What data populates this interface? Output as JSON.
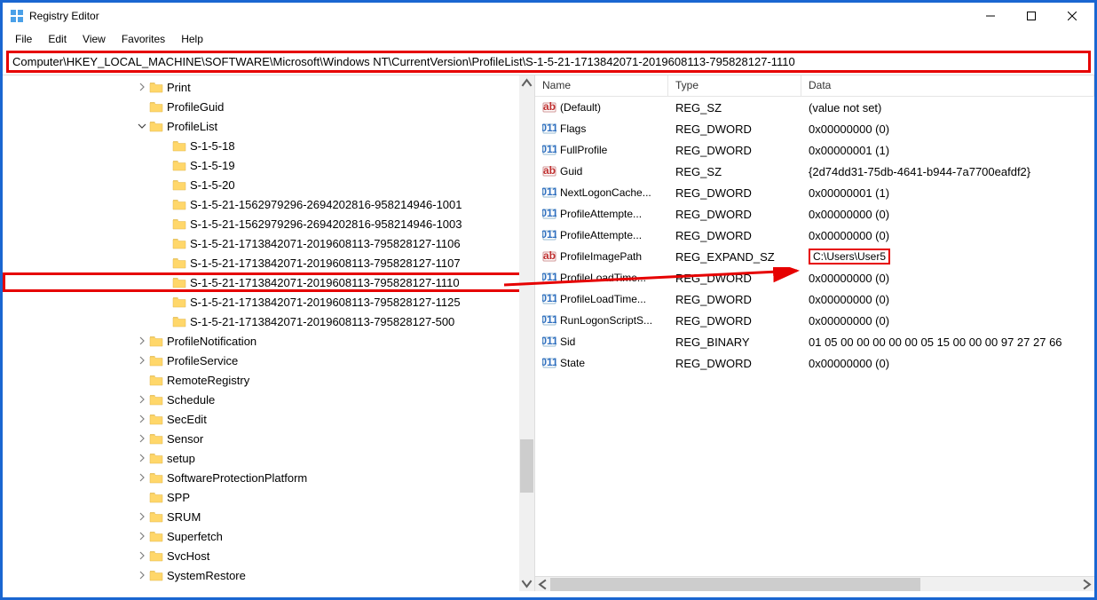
{
  "window": {
    "title": "Registry Editor"
  },
  "menubar": [
    "File",
    "Edit",
    "View",
    "Favorites",
    "Help"
  ],
  "addressbar": "Computer\\HKEY_LOCAL_MACHINE\\SOFTWARE\\Microsoft\\Windows NT\\CurrentVersion\\ProfileList\\S-1-5-21-1713842071-2019608113-795828127-1110",
  "tree": [
    {
      "indent": 150,
      "expander": "right",
      "label": "Print"
    },
    {
      "indent": 150,
      "expander": "",
      "label": "ProfileGuid"
    },
    {
      "indent": 150,
      "expander": "down",
      "label": "ProfileList"
    },
    {
      "indent": 176,
      "expander": "",
      "label": "S-1-5-18"
    },
    {
      "indent": 176,
      "expander": "",
      "label": "S-1-5-19"
    },
    {
      "indent": 176,
      "expander": "",
      "label": "S-1-5-20"
    },
    {
      "indent": 176,
      "expander": "",
      "label": "S-1-5-21-1562979296-2694202816-958214946-1001"
    },
    {
      "indent": 176,
      "expander": "",
      "label": "S-1-5-21-1562979296-2694202816-958214946-1003"
    },
    {
      "indent": 176,
      "expander": "",
      "label": "S-1-5-21-1713842071-2019608113-795828127-1106"
    },
    {
      "indent": 176,
      "expander": "",
      "label": "S-1-5-21-1713842071-2019608113-795828127-1107"
    },
    {
      "indent": 176,
      "expander": "",
      "label": "S-1-5-21-1713842071-2019608113-795828127-1110",
      "selected": true
    },
    {
      "indent": 176,
      "expander": "",
      "label": "S-1-5-21-1713842071-2019608113-795828127-1125"
    },
    {
      "indent": 176,
      "expander": "",
      "label": "S-1-5-21-1713842071-2019608113-795828127-500"
    },
    {
      "indent": 150,
      "expander": "right",
      "label": "ProfileNotification"
    },
    {
      "indent": 150,
      "expander": "right",
      "label": "ProfileService"
    },
    {
      "indent": 150,
      "expander": "",
      "label": "RemoteRegistry"
    },
    {
      "indent": 150,
      "expander": "right",
      "label": "Schedule"
    },
    {
      "indent": 150,
      "expander": "right",
      "label": "SecEdit"
    },
    {
      "indent": 150,
      "expander": "right",
      "label": "Sensor"
    },
    {
      "indent": 150,
      "expander": "right",
      "label": "setup"
    },
    {
      "indent": 150,
      "expander": "right",
      "label": "SoftwareProtectionPlatform"
    },
    {
      "indent": 150,
      "expander": "",
      "label": "SPP"
    },
    {
      "indent": 150,
      "expander": "right",
      "label": "SRUM"
    },
    {
      "indent": 150,
      "expander": "right",
      "label": "Superfetch"
    },
    {
      "indent": 150,
      "expander": "right",
      "label": "SvcHost"
    },
    {
      "indent": 150,
      "expander": "right",
      "label": "SystemRestore"
    }
  ],
  "list": {
    "headers": {
      "name": "Name",
      "type": "Type",
      "data": "Data"
    },
    "rows": [
      {
        "icon": "str",
        "name": "(Default)",
        "type": "REG_SZ",
        "data": "(value not set)"
      },
      {
        "icon": "bin",
        "name": "Flags",
        "type": "REG_DWORD",
        "data": "0x00000000 (0)"
      },
      {
        "icon": "bin",
        "name": "FullProfile",
        "type": "REG_DWORD",
        "data": "0x00000001 (1)"
      },
      {
        "icon": "str",
        "name": "Guid",
        "type": "REG_SZ",
        "data": "{2d74dd31-75db-4641-b944-7a7700eafdf2}"
      },
      {
        "icon": "bin",
        "name": "NextLogonCache...",
        "type": "REG_DWORD",
        "data": "0x00000001 (1)"
      },
      {
        "icon": "bin",
        "name": "ProfileAttempte...",
        "type": "REG_DWORD",
        "data": "0x00000000 (0)"
      },
      {
        "icon": "bin",
        "name": "ProfileAttempte...",
        "type": "REG_DWORD",
        "data": "0x00000000 (0)"
      },
      {
        "icon": "str",
        "name": "ProfileImagePath",
        "type": "REG_EXPAND_SZ",
        "data": "C:\\Users\\User5",
        "highlight": true
      },
      {
        "icon": "bin",
        "name": "ProfileLoadTime...",
        "type": "REG_DWORD",
        "data": "0x00000000 (0)"
      },
      {
        "icon": "bin",
        "name": "ProfileLoadTime...",
        "type": "REG_DWORD",
        "data": "0x00000000 (0)"
      },
      {
        "icon": "bin",
        "name": "RunLogonScriptS...",
        "type": "REG_DWORD",
        "data": "0x00000000 (0)"
      },
      {
        "icon": "bin",
        "name": "Sid",
        "type": "REG_BINARY",
        "data": "01 05 00 00 00 00 00 05 15 00 00 00 97 27 27 66"
      },
      {
        "icon": "bin",
        "name": "State",
        "type": "REG_DWORD",
        "data": "0x00000000 (0)"
      }
    ]
  }
}
